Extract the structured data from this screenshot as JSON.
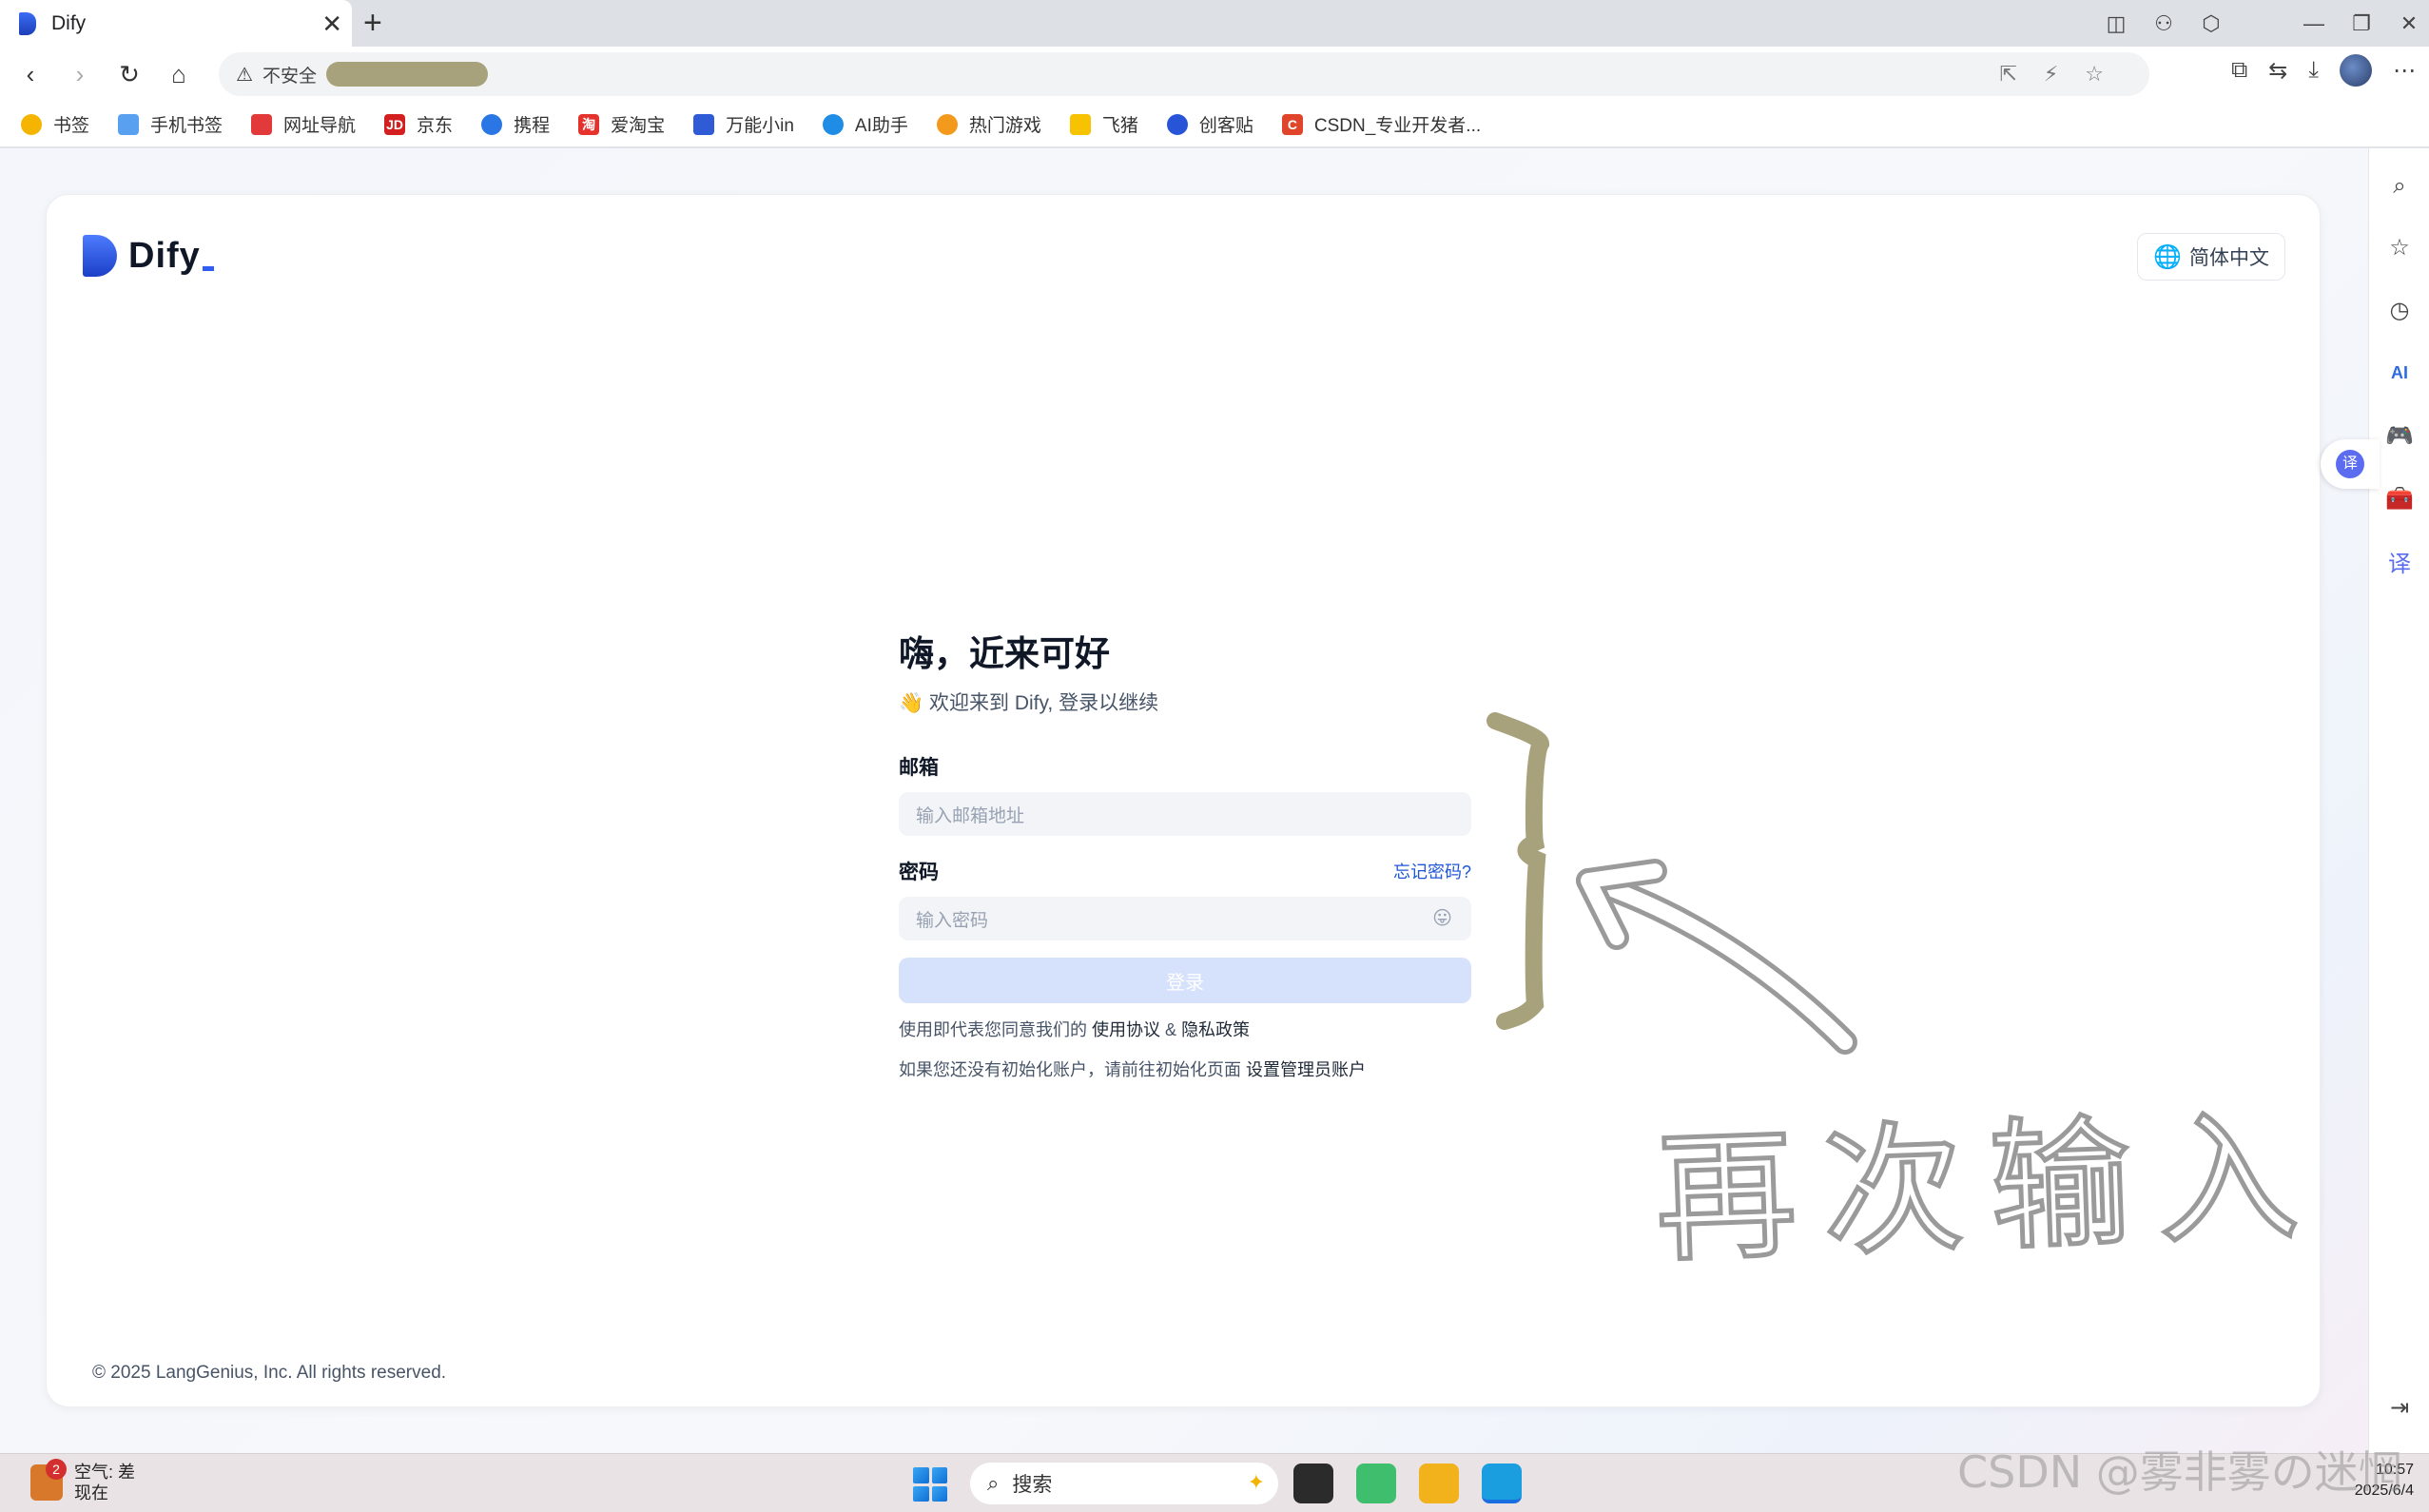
{
  "browser": {
    "tab_title": "Dify",
    "tab_close": "✕",
    "new_tab": "+",
    "address_warning_label": "不安全",
    "window_controls": [
      "—",
      "❐",
      "✕"
    ],
    "bookmarks": [
      {
        "label": "书签",
        "color": "#f5b400"
      },
      {
        "label": "手机书签",
        "color": "#5aa0f0"
      },
      {
        "label": "网址导航",
        "color": "#e23a3a"
      },
      {
        "label": "京东",
        "color": "#d31f1f"
      },
      {
        "label": "携程",
        "color": "#2b76e5"
      },
      {
        "label": "爱淘宝",
        "color": "#e5322d"
      },
      {
        "label": "万能小in",
        "color": "#2f5bd6"
      },
      {
        "label": "AI助手",
        "color": "#1f8ce6"
      },
      {
        "label": "热门游戏",
        "color": "#f39a1c"
      },
      {
        "label": "飞猪",
        "color": "#f7c300"
      },
      {
        "label": "创客贴",
        "color": "#2854d8"
      },
      {
        "label": "CSDN_专业开发者...",
        "color": "#e0442a"
      }
    ]
  },
  "page": {
    "brand": "Dify",
    "language_button": "简体中文",
    "heading": "嗨，近来可好",
    "subheading": "👋 欢迎来到 Dify, 登录以继续",
    "email_label": "邮箱",
    "email_placeholder": "输入邮箱地址",
    "password_label": "密码",
    "forgot_password": "忘记密码?",
    "password_placeholder": "输入密码",
    "login_button": "登录",
    "terms_prefix": "使用即代表您同意我们的",
    "terms_link": "使用协议",
    "terms_and": "&",
    "privacy_link": "隐私政策",
    "init_prefix": "如果您还没有初始化账户，请前往初始化页面",
    "init_link": "设置管理员账户",
    "copyright": "© 2025 LangGenius, Inc. All rights reserved."
  },
  "annotation": {
    "text": "再次输入",
    "color": "#a7a27b"
  },
  "taskbar": {
    "weather_badge": "2",
    "weather_line1": "空气: 差",
    "weather_line2": "现在",
    "search_label": "搜索",
    "time": "10:57",
    "date": "2025/6/4"
  },
  "watermark": "CSDN @雾非雾の迷惘"
}
